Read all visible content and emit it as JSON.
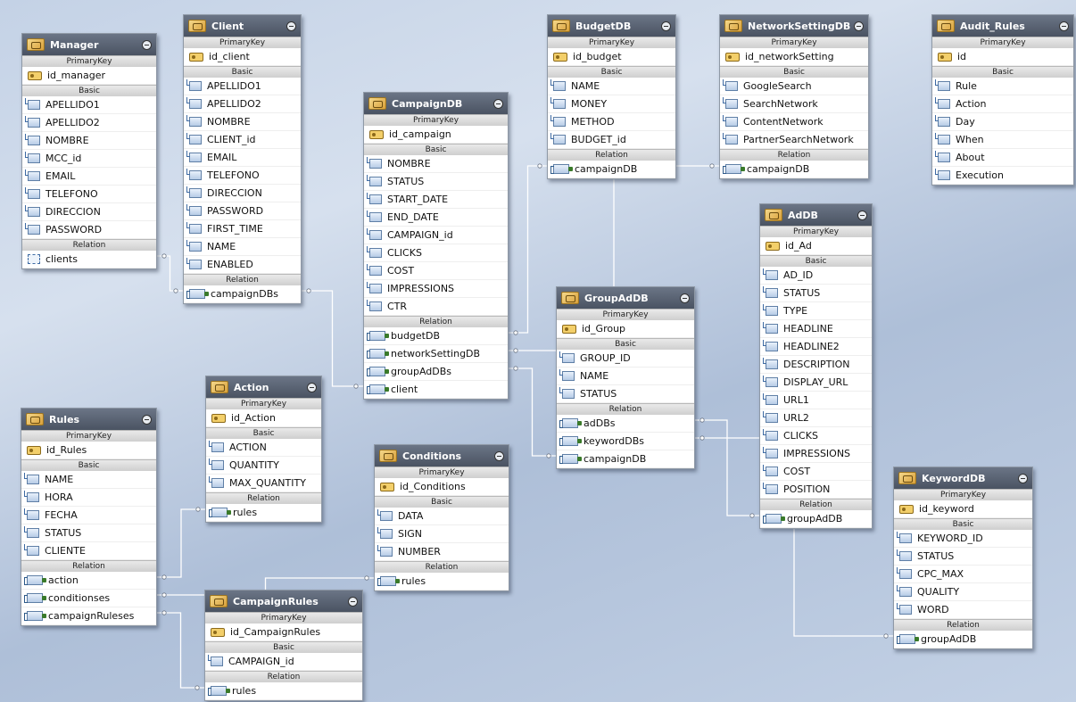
{
  "diagram": {
    "entities": [
      {
        "id": "Manager",
        "name": "Manager",
        "primary_key": "id_manager",
        "basic": [
          "APELLIDO1",
          "APELLIDO2",
          "NOMBRE",
          "MCC_id",
          "EMAIL",
          "TELEFONO",
          "DIRECCION",
          "PASSWORD"
        ],
        "relation": [
          {
            "name": "clients",
            "selected": true
          }
        ]
      },
      {
        "id": "Client",
        "name": "Client",
        "primary_key": "id_client",
        "basic": [
          "APELLIDO1",
          "APELLIDO2",
          "NOMBRE",
          "CLIENT_id",
          "EMAIL",
          "TELEFONO",
          "DIRECCION",
          "PASSWORD",
          "FIRST_TIME",
          "NAME",
          "ENABLED"
        ],
        "relation": [
          {
            "name": "campaignDBs"
          }
        ]
      },
      {
        "id": "CampaignDB",
        "name": "CampaignDB",
        "primary_key": "id_campaign",
        "basic": [
          "NOMBRE",
          "STATUS",
          "START_DATE",
          "END_DATE",
          "CAMPAIGN_id",
          "CLICKS",
          "COST",
          "IMPRESSIONS",
          "CTR"
        ],
        "relation": [
          {
            "name": "budgetDB"
          },
          {
            "name": "networkSettingDB"
          },
          {
            "name": "groupAdDBs"
          },
          {
            "name": "client"
          }
        ]
      },
      {
        "id": "BudgetDB",
        "name": "BudgetDB",
        "primary_key": "id_budget",
        "basic": [
          "NAME",
          "MONEY",
          "METHOD",
          "BUDGET_id"
        ],
        "relation": [
          {
            "name": "campaignDB"
          }
        ]
      },
      {
        "id": "NetworkSettingDB",
        "name": "NetworkSettingDB",
        "primary_key": "id_networkSetting",
        "basic": [
          "GoogleSearch",
          "SearchNetwork",
          "ContentNetwork",
          "PartnerSearchNetwork"
        ],
        "relation": [
          {
            "name": "campaignDB"
          }
        ]
      },
      {
        "id": "Audit_Rules",
        "name": "Audit_Rules",
        "primary_key": "id",
        "basic": [
          "Rule",
          "Action",
          "Day",
          "When",
          "About",
          "Execution"
        ],
        "relation": []
      },
      {
        "id": "AdDB",
        "name": "AdDB",
        "primary_key": "id_Ad",
        "basic": [
          "AD_ID",
          "STATUS",
          "TYPE",
          "HEADLINE",
          "HEADLINE2",
          "DESCRIPTION",
          "DISPLAY_URL",
          "URL1",
          "URL2",
          "CLICKS",
          "IMPRESSIONS",
          "COST",
          "POSITION"
        ],
        "relation": [
          {
            "name": "groupAdDB"
          }
        ]
      },
      {
        "id": "GroupAdDB",
        "name": "GroupAdDB",
        "primary_key": "id_Group",
        "basic": [
          "GROUP_ID",
          "NAME",
          "STATUS"
        ],
        "relation": [
          {
            "name": "adDBs"
          },
          {
            "name": "keywordDBs"
          },
          {
            "name": "campaignDB"
          }
        ]
      },
      {
        "id": "Action",
        "name": "Action",
        "primary_key": "id_Action",
        "basic": [
          "ACTION",
          "QUANTITY",
          "MAX_QUANTITY"
        ],
        "relation": [
          {
            "name": "rules"
          }
        ]
      },
      {
        "id": "Rules",
        "name": "Rules",
        "primary_key": "id_Rules",
        "basic": [
          "NAME",
          "HORA",
          "FECHA",
          "STATUS",
          "CLIENTE"
        ],
        "relation": [
          {
            "name": "action"
          },
          {
            "name": "conditionses"
          },
          {
            "name": "campaignRuleses"
          }
        ]
      },
      {
        "id": "Conditions",
        "name": "Conditions",
        "primary_key": "id_Conditions",
        "basic": [
          "DATA",
          "SIGN",
          "NUMBER"
        ],
        "relation": [
          {
            "name": "rules"
          }
        ]
      },
      {
        "id": "CampaignRules",
        "name": "CampaignRules",
        "primary_key": "id_CampaignRules",
        "basic": [
          "CAMPAIGN_id"
        ],
        "relation": [
          {
            "name": "rules"
          }
        ]
      },
      {
        "id": "KeywordDB",
        "name": "KeywordDB",
        "primary_key": "id_keyword",
        "basic": [
          "KEYWORD_ID",
          "STATUS",
          "CPC_MAX",
          "QUALITY",
          "WORD"
        ],
        "relation": [
          {
            "name": "groupAdDB"
          }
        ]
      }
    ],
    "section_labels": {
      "primary": "PrimaryKey",
      "basic": "Basic",
      "relation": "Relation"
    },
    "connections": [
      {
        "from": "Manager.clients",
        "to": "Client.campaignDBs"
      },
      {
        "from": "Client.campaignDBs",
        "to": "CampaignDB.client"
      },
      {
        "from": "CampaignDB.budgetDB",
        "to": "BudgetDB.campaignDB"
      },
      {
        "from": "CampaignDB.networkSettingDB",
        "to": "NetworkSettingDB.campaignDB"
      },
      {
        "from": "CampaignDB.groupAdDBs",
        "to": "GroupAdDB.campaignDB"
      },
      {
        "from": "GroupAdDB.adDBs",
        "to": "AdDB.groupAdDB"
      },
      {
        "from": "GroupAdDB.keywordDBs",
        "to": "KeywordDB.groupAdDB"
      },
      {
        "from": "Rules.action",
        "to": "Action.rules"
      },
      {
        "from": "Rules.conditionses",
        "to": "Conditions.rules"
      },
      {
        "from": "Rules.campaignRuleses",
        "to": "CampaignRules.rules"
      }
    ],
    "colors": {
      "header": "#5a6373",
      "section": "#d9d9d9",
      "connector": "#ffffff"
    }
  }
}
